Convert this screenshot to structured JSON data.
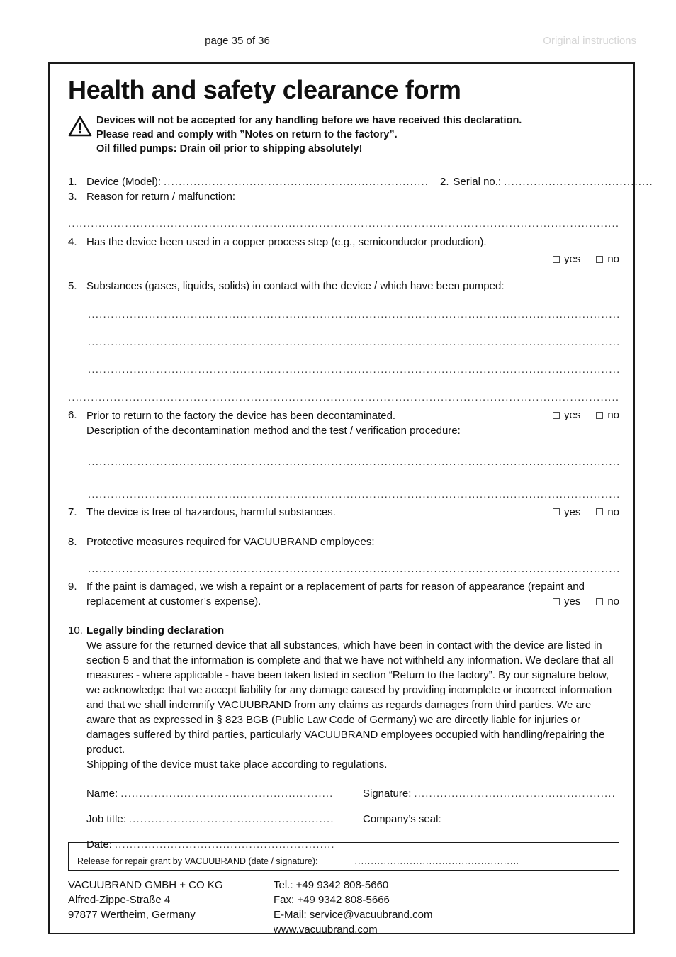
{
  "header": {
    "page_number": "page 35 of 36",
    "original_instructions": "Original instructions"
  },
  "form": {
    "title": "Health and safety clearance form",
    "warning": {
      "icon": "warning-triangle-icon",
      "line1": "Devices will not be accepted for any handling before we have received this declaration.",
      "line2": "Please read and comply with ”Notes on return to the factory”.",
      "line3": "Oil filled pumps: Drain oil prior to shipping absolutely!"
    },
    "items": {
      "n1": "1.",
      "item1_label": "Device (Model):",
      "n2": "2.",
      "item2_label": "Serial no.:",
      "n3": "3.",
      "item3_label": "Reason for return / malfunction:",
      "n4": "4.",
      "item4_label": "Has the device been used in a copper process step (e.g., semiconductor production).",
      "n5": "5.",
      "item5_label": "Substances (gases, liquids, solids) in contact with the device / which have been pumped:",
      "n6": "6.",
      "item6_label": "Prior to return to the factory the device has been decontaminated.",
      "item6_sub": "Description of the decontamination method and the test / verification procedure:",
      "n7": "7.",
      "item7_label": "The device is free of hazardous, harmful substances.",
      "n8": "8.",
      "item8_label": "Protective measures required for VACUUBRAND employees:",
      "n9": "9.",
      "item9_label": "If the paint is damaged, we wish a repaint or a replacement of parts for reason of appearance (repaint and replacement at customer’s expense).",
      "n10": "10.",
      "item10_label": "Legally binding declaration",
      "item10_para": "We assure for the returned device that all substances, which have been in contact with the device are listed in section 5 and that the information is complete and that we have not withheld any information. We declare that all measures - where applicable - have been taken listed in section “Return to the factory”. By our signature below, we acknowledge that we accept liability for any damage caused by providing incomplete or incorrect information and that we shall indemnify VACUUBRAND from any claims as regards damages from third parties. We are aware that as expressed in § 823 BGB (Public Law Code of Germany) we are directly liable for injuries or damages suffered by third parties, particularly VACUUBRAND employees occupied with handling/repairing the product.",
      "item10_para2": "Shipping of the device must take place according to regulations."
    },
    "checkbox": {
      "yes": "yes",
      "no": "no"
    },
    "signature": {
      "name_label": "Name:",
      "signature_label": "Signature:",
      "jobtitle_label": "Job title:",
      "company_seal_label": "Company’s seal:",
      "date_label": "Date:"
    },
    "release": {
      "label": "Release for repair grant by VACUUBRAND (date / signature):"
    },
    "footer": {
      "company": "VACUUBRAND GMBH + CO KG",
      "street": "Alfred-Zippe-Straße 4",
      "city": "97877 Wertheim, Germany",
      "tel": "Tel.: +49 9342 808-5660",
      "fax": "Fax: +49 9342 808-5666",
      "email": "E-Mail: service@vacuubrand.com",
      "web": "www.vacuubrand.com"
    },
    "leaders": {
      "short": "..................................................................",
      "medium": "........................................",
      "long": "................................................................................................................................................................................",
      "release": ".............................................................."
    }
  }
}
